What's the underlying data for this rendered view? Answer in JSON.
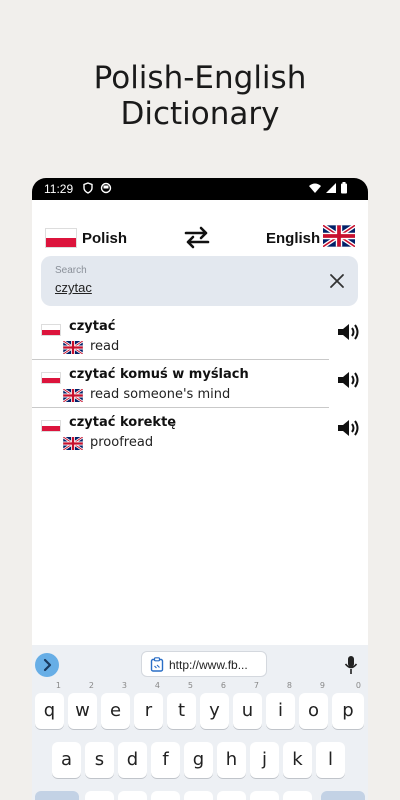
{
  "promo": {
    "line1": "Polish-English",
    "line2": "Dictionary"
  },
  "status": {
    "time": "11:29"
  },
  "languages": {
    "source": "Polish",
    "target": "English"
  },
  "search": {
    "placeholder": "Search",
    "value": "czytac"
  },
  "results": [
    {
      "source": "czytać",
      "target": "read"
    },
    {
      "source": "czytać komuś w myślach",
      "target": "read someone's mind"
    },
    {
      "source": "czytać korektę",
      "target": "proofread"
    }
  ],
  "keyboard": {
    "url": "http://www.fb...",
    "row1": [
      "q",
      "w",
      "e",
      "r",
      "t",
      "y",
      "u",
      "i",
      "o",
      "p"
    ],
    "row1_hints": [
      "1",
      "2",
      "3",
      "4",
      "5",
      "6",
      "7",
      "8",
      "9",
      "0"
    ],
    "row2": [
      "a",
      "s",
      "d",
      "f",
      "g",
      "h",
      "j",
      "k",
      "l"
    ],
    "row3": [
      "z",
      "x",
      "c",
      "v",
      "b",
      "n",
      "m"
    ]
  },
  "colors": {
    "accent": "#67aee6",
    "search_bg": "#e3e8ef",
    "pl_red": "#dc143c",
    "uk_blue": "#012169"
  }
}
